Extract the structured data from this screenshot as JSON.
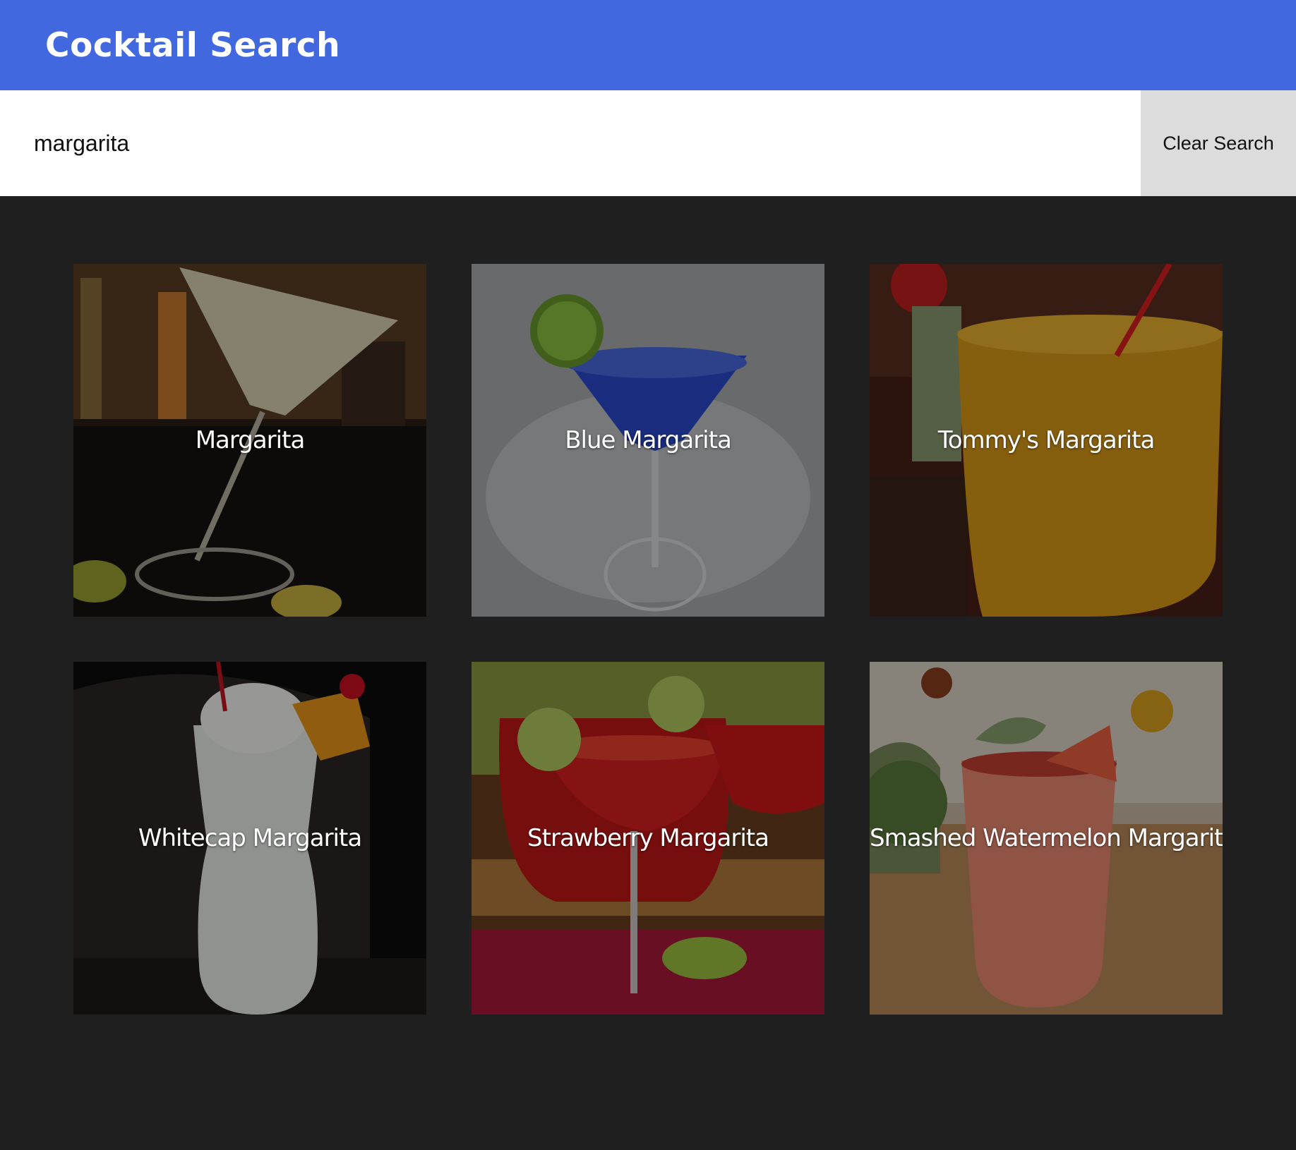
{
  "header": {
    "title": "Cocktail Search",
    "color": "#4268e0"
  },
  "search": {
    "value": "margarita",
    "clear_label": "Clear Search"
  },
  "results": [
    {
      "name": "Margarita",
      "image": "margarita-photo"
    },
    {
      "name": "Blue Margarita",
      "image": "blue-margarita-photo"
    },
    {
      "name": "Tommy's Margarita",
      "image": "tommys-margarita-photo"
    },
    {
      "name": "Whitecap Margarita",
      "image": "whitecap-margarita-photo"
    },
    {
      "name": "Strawberry Margarita",
      "image": "strawberry-margarita-photo"
    },
    {
      "name": "Smashed Watermelon Margarita",
      "image": "smashed-watermelon-margarita-photo"
    }
  ],
  "colors": {
    "background": "#201f20",
    "clear_button": "#dcdcdc"
  }
}
